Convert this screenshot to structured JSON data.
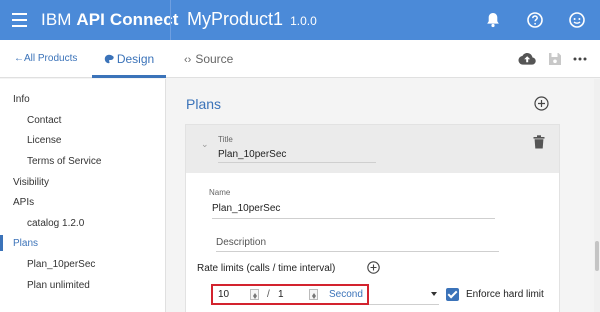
{
  "header": {
    "brand_prefix": "IBM",
    "brand_main": "API Connect",
    "product_name": "MyProduct1",
    "product_version": "1.0.0",
    "icons": [
      "bell-icon",
      "help-icon",
      "user-avatar-icon"
    ],
    "bg_color": "#4b8ad8"
  },
  "tabs": {
    "back_label": "All Products",
    "design_label": "Design",
    "source_label": "Source",
    "source_prefix": "‹›",
    "back_prefix": "←"
  },
  "sidebar": {
    "items": [
      {
        "label": "Info"
      },
      {
        "label": "Contact"
      },
      {
        "label": "License"
      },
      {
        "label": "Terms of Service"
      },
      {
        "label": "Visibility"
      },
      {
        "label": "APIs"
      },
      {
        "label": "catalog 1.2.0"
      },
      {
        "label": "Plans"
      },
      {
        "label": "Plan_10perSec"
      },
      {
        "label": "Plan unlimited"
      }
    ],
    "active_item": "Plans"
  },
  "main": {
    "section_title": "Plans",
    "plan": {
      "title_label": "Title",
      "title_value": "Plan_10perSec",
      "name_label": "Name",
      "name_value": "Plan_10perSec",
      "description_placeholder": "Description",
      "rate_limits_label": "Rate limits (calls / time interval)",
      "rate_calls": "10",
      "rate_separator": "/",
      "rate_interval": "1",
      "rate_unit": "Second",
      "enforce_hard_limit_label": "Enforce hard limit",
      "enforce_hard_limit_checked": true
    }
  },
  "colors": {
    "accent": "#3b73b9",
    "highlight_border": "#d3232e"
  }
}
